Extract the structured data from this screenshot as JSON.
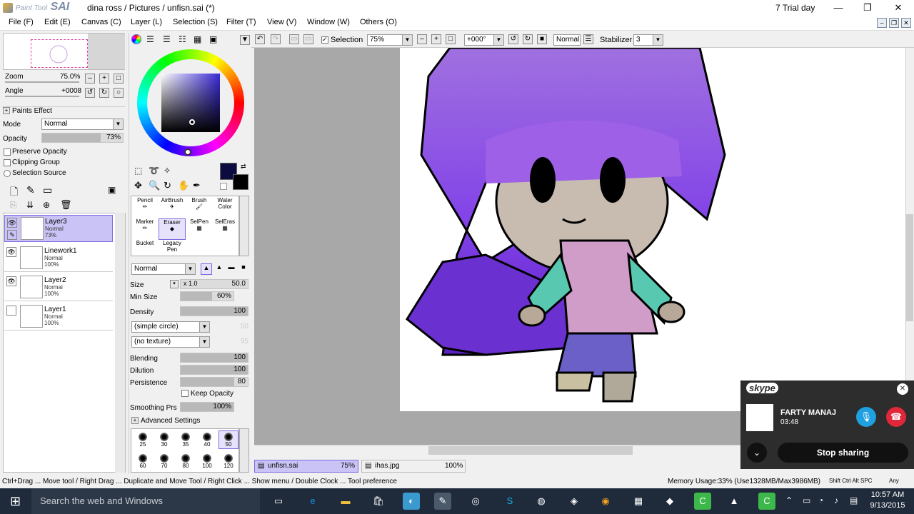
{
  "window": {
    "app_name": "SAI",
    "app_prefix": "Paint Tool",
    "document_title": "dina ross / Pictures / unfisn.sai (*)",
    "trial_text": "7 Trial day",
    "minimize": "—",
    "restore": "❐",
    "close": "✕"
  },
  "menu": [
    "File (F)",
    "Edit (E)",
    "Canvas (C)",
    "Layer (L)",
    "Selection (S)",
    "Filter (T)",
    "View (V)",
    "Window (W)",
    "Others (O)"
  ],
  "navigator": {
    "zoom_label": "Zoom",
    "zoom_value": "75.0%",
    "angle_label": "Angle",
    "angle_value": "+0008"
  },
  "layer_props": {
    "paints_effect": "Paints Effect",
    "mode_label": "Mode",
    "mode_value": "Normal",
    "opacity_label": "Opacity",
    "opacity_value": "73%",
    "opacity_fraction": 0.73,
    "preserve_opacity": "Preserve Opacity",
    "clipping_group": "Clipping Group",
    "selection_source": "Selection Source"
  },
  "layers": [
    {
      "name": "Layer3",
      "mode": "Normal",
      "opacity": "73%",
      "active": true
    },
    {
      "name": "Linework1",
      "mode": "Normal",
      "opacity": "100%",
      "active": false
    },
    {
      "name": "Layer2",
      "mode": "Normal",
      "opacity": "100%",
      "active": false
    },
    {
      "name": "Layer1",
      "mode": "Normal",
      "opacity": "100%",
      "active": false
    }
  ],
  "tools": {
    "row1": [
      "Pencil",
      "AirBrush",
      "Brush",
      "Water Color"
    ],
    "row2": [
      "Marker",
      "Eraser",
      "SelPen",
      "SelEras"
    ],
    "row3": [
      "Bucket",
      "Legacy Pen"
    ]
  },
  "brush_settings": {
    "blend_mode": "Normal",
    "size_label": "Size",
    "size_mult": "x 1.0",
    "size_value": "50.0",
    "min_size_label": "Min Size",
    "min_size_value": "60%",
    "density_label": "Density",
    "density_value": "100",
    "shape": "(simple circle)",
    "shape_value": "50",
    "texture": "(no texture)",
    "texture_value": "95",
    "blending_label": "Blending",
    "blending_value": "100",
    "dilution_label": "Dilution",
    "dilution_value": "100",
    "persistence_label": "Persistence",
    "persistence_value": "80",
    "keep_opacity": "Keep Opacity",
    "smoothing_label": "Smoothing Prs",
    "smoothing_value": "100%",
    "advanced": "Advanced Settings",
    "presets_row1": [
      "25",
      "30",
      "35",
      "40",
      "50"
    ],
    "presets_row2": [
      "60",
      "70",
      "80",
      "100",
      "120"
    ]
  },
  "toolbar": {
    "selection_label": "Selection",
    "zoom": "75%",
    "angle": "+000°",
    "mode": "Normal",
    "stabilizer_label": "Stabilizer",
    "stabilizer_value": "3"
  },
  "doc_tabs": [
    {
      "name": "unfisn.sai",
      "zoom": "75%",
      "active": true
    },
    {
      "name": "ihas.jpg",
      "zoom": "100%",
      "active": false
    }
  ],
  "status": {
    "hint": "Ctrl+Drag ... Move tool / Right Drag ... Duplicate and Move Tool / Right Click ... Show menu / Double Clock ... Tool preference",
    "memory": "Memory Usage:33% (Use1328MB/Max3986MB)",
    "keys": "Shift Ctrl Alt SPC",
    "any": "Any"
  },
  "skype": {
    "logo": "skype",
    "caller": "FARTY MANAJ",
    "duration": "03:48",
    "stop_sharing": "Stop sharing"
  },
  "taskbar": {
    "search_placeholder": "Search the web and Windows",
    "time": "10:57 AM",
    "date": "9/13/2015"
  },
  "colors": {
    "accent": "#7d6be0",
    "current_color": "#0b0b40",
    "taskbar": "#1f2a3a",
    "skype_end": "#e0283a",
    "skype_mic": "#1fa0e0"
  }
}
